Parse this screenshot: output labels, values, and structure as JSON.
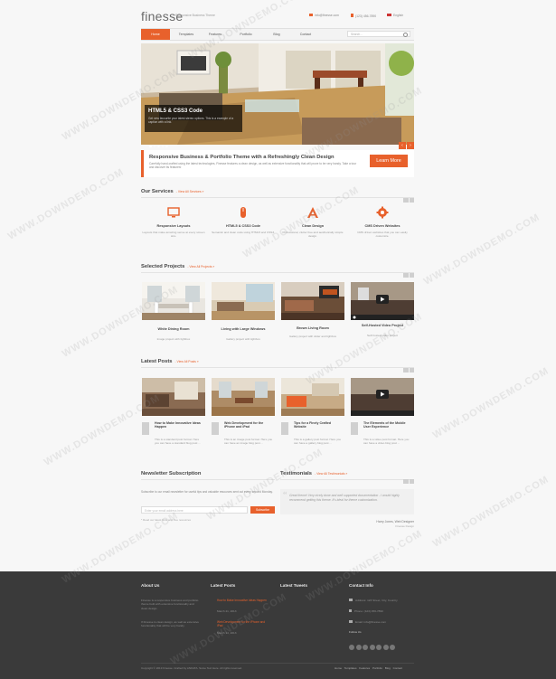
{
  "header": {
    "logo": "finesse",
    "tagline": "Responsive Business Theme",
    "email": "info@finesse.com",
    "phone": "(123) 456-7890",
    "language": "English"
  },
  "nav": {
    "items": [
      "Home",
      "Templates",
      "Features",
      "Portfolio",
      "Blog",
      "Contact"
    ],
    "search_placeholder": "Search..."
  },
  "slider": {
    "title": "HTML5 & CSS3 Code",
    "text": "Get new favourite your latest stereo options. This is a example of a caption with a link."
  },
  "promo": {
    "title": "Responsive Business & Portfolio Theme with a Refreshingly Clean Design",
    "text": "Carefully hand-crafted using the latest technologies, Finesse features a clean design, as well as extensive functionality that will prove to be very handy. Take a tour and discover its features!",
    "button": "Learn More"
  },
  "services": {
    "title": "Our Services",
    "link": "- View All Services »",
    "items": [
      {
        "title": "Responsive Layouts",
        "text": "Layouts that make amazing sense at every screen size.",
        "icon": "monitor-icon"
      },
      {
        "title": "HTML5 & CSS3 Code",
        "text": "Semantic and clean code using HTML5 and CSS3.",
        "icon": "mouse-icon"
      },
      {
        "title": "Clean Design",
        "text": "Professional, clutter free and aesthetically simple design.",
        "icon": "letter-a-icon"
      },
      {
        "title": "CMS Driven Websites",
        "text": "CMS driven websites that you can easily customize.",
        "icon": "gear-icon"
      }
    ]
  },
  "projects": {
    "title": "Selected Projects",
    "link": "- View All Projects »",
    "items": [
      {
        "title": "White Dining Room",
        "text": "Image project with lightbox"
      },
      {
        "title": "Living with Large Windows",
        "text": "Gallery project with lightbox"
      },
      {
        "title": "Brown Living Room",
        "text": "Gallery project with slider and lightbox"
      },
      {
        "title": "Self-Hosted Video Project",
        "text": "Self-hosted video project"
      }
    ]
  },
  "posts": {
    "title": "Latest Posts",
    "link": "- View All Posts »",
    "items": [
      {
        "title": "How to Make Innovative Ideas Happen",
        "text": "This is a standard post format. Here you can have a standard blog post ..."
      },
      {
        "title": "Web Development for the iPhone and iPad",
        "text": "This is an image post format. Here you can have an image blog post ..."
      },
      {
        "title": "Tips for a Finely Crafted Website",
        "text": "This is a gallery post format. Here you can have a gallery blog post ..."
      },
      {
        "title": "The Elements of the Mobile User Experience",
        "text": "This is a video post format. Here you can have a video blog post ..."
      }
    ]
  },
  "newsletter": {
    "title": "Newsletter Subscription",
    "text": "Subscribe to our email newsletter for useful tips and valuable resources sent out every second Monday.",
    "placeholder": "Enter your email address here",
    "button": "Subscribe",
    "note": "* Read our latest links and free resources"
  },
  "testimonials": {
    "title": "Testimonials",
    "link": "- View All Testimonials »",
    "quote": "Great theme! Very nicely done and well supported documentation - I would highly recommend getting this theme. It's ideal for theme customization.",
    "author": "Harry Jones, Web Designer",
    "company": "Finesse Design"
  },
  "footer": {
    "about_title": "About Us",
    "about_text": "Finesse is a responsive business and portfolio theme built with extensive functionality and clean design.",
    "about_text2": "If Finesse is clean design, as well as extensive functionality that will be very handy.",
    "posts_title": "Latest Posts",
    "post1": "How to Make Innovative Ideas Happen",
    "post1_date": "March 21, 2013",
    "post2": "Web Development for the iPhone and iPad",
    "post2_date": "March 14, 2013",
    "tweets_title": "Latest Tweets",
    "contact_title": "Contact Info",
    "address": "Address: 123 Street, City, Country",
    "phone": "Phone: (123) 456-7890",
    "email": "Email: info@finesse.com",
    "follow_us": "Follow Us",
    "copyright": "Copyright © 2013 Finesse. Crafted by ANKATA. Some Text Here. All rights reserved.",
    "nav": "Home Templates Features Portfolio Blog Contact"
  },
  "watermark": "WWW.DOWNDEMO.COM"
}
